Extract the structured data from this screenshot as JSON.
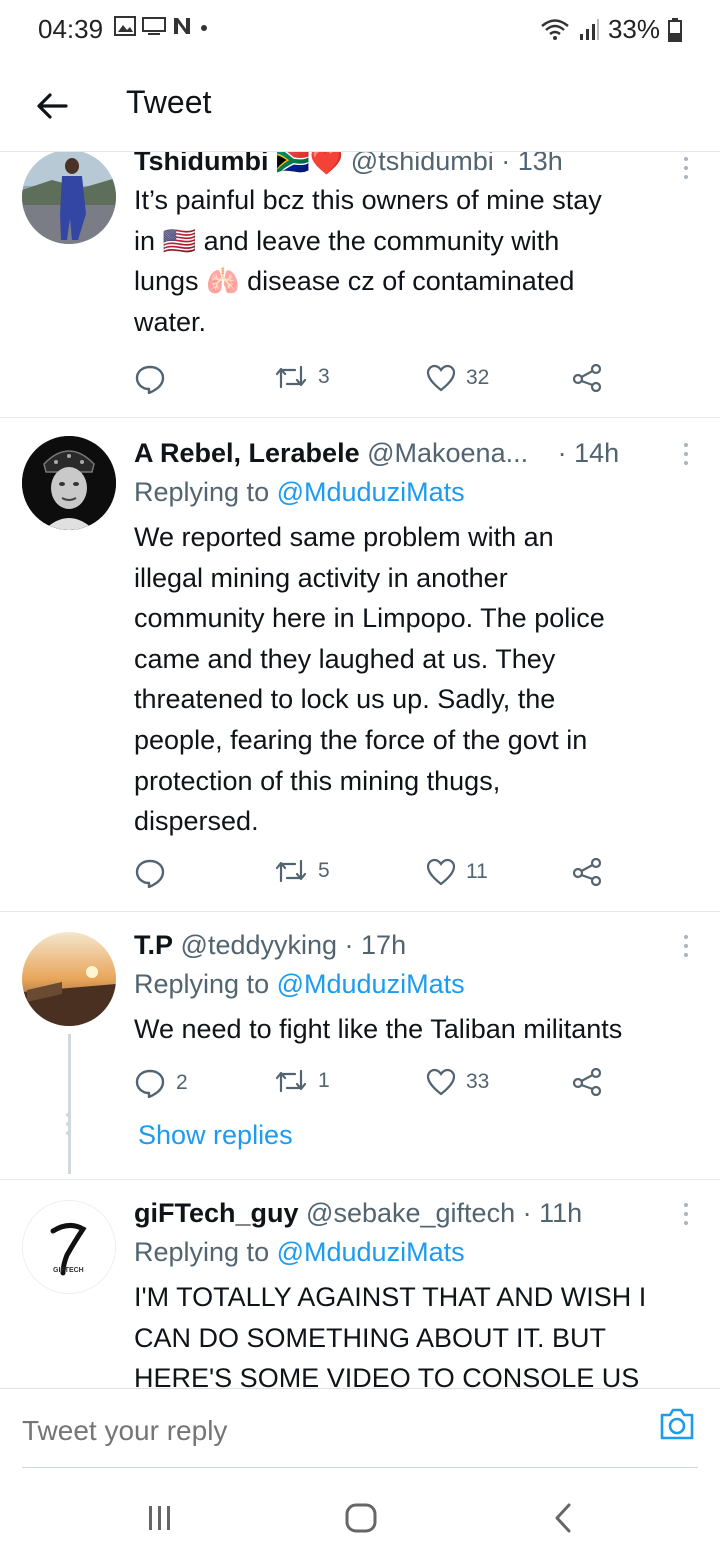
{
  "status_bar": {
    "time": "04:39",
    "battery": "33%"
  },
  "header": {
    "title": "Tweet"
  },
  "tweets": [
    {
      "name": "Tshidumbi",
      "name_emoji": "🇿🇦❤️",
      "handle": "@tshidumbi",
      "time": "· 13h",
      "replying_to": "",
      "lines": [
        "It’s painful bcz this owners of mine stay",
        "in 🇺🇸 and leave the community with",
        "lungs 🫁 disease cz of contaminated",
        "water."
      ],
      "replies": "",
      "retweets": "3",
      "likes": "32"
    },
    {
      "name": "A Rebel, Lerabele",
      "handle": "@Makoena...",
      "time": "· 14h",
      "replying_prefix": "Replying to",
      "replying_to": "@MduduziMats",
      "lines": [
        "We reported same problem with an",
        "illegal mining activity in another",
        "community here in Limpopo. The police",
        "came and they laughed at us. They",
        "threatened to lock us up. Sadly, the",
        "people, fearing the force of the govt in",
        "protection of this mining thugs,",
        "dispersed."
      ],
      "replies": "",
      "retweets": "5",
      "likes": "11"
    },
    {
      "name": "T.P",
      "handle": "@teddyyking",
      "time": "· 17h",
      "replying_prefix": "Replying to",
      "replying_to": "@MduduziMats",
      "lines": [
        "We need to fight like the Taliban militants"
      ],
      "replies": "2",
      "retweets": "1",
      "likes": "33",
      "show_replies": "Show replies"
    },
    {
      "name": "giFTech_guy",
      "handle": "@sebake_giftech",
      "time": "· 11h",
      "replying_prefix": "Replying to",
      "replying_to": "@MduduziMats",
      "avatar_text": "GIFTECH",
      "lines": [
        "I'M TOTALLY AGAINST THAT AND WISH I",
        "CAN DO SOMETHING ABOUT IT. BUT",
        "HERE'S SOME VIDEO TO CONSOLE US"
      ]
    }
  ],
  "composer": {
    "placeholder": "Tweet your reply"
  },
  "colors": {
    "accent": "#1d9bf0",
    "secondary": "#536471"
  }
}
